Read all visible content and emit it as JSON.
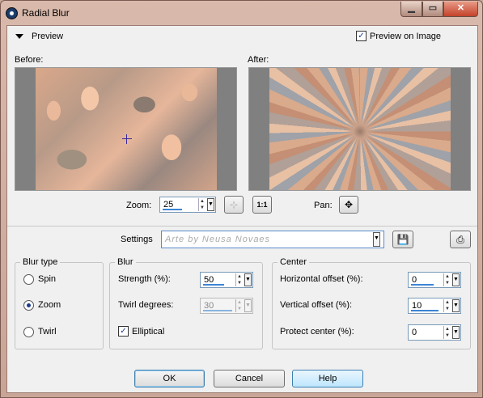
{
  "window": {
    "title": "Radial Blur"
  },
  "preview": {
    "toggle_label": "Preview",
    "preview_on_image_label": "Preview on Image",
    "preview_on_image_checked": true,
    "before_label": "Before:",
    "after_label": "After:",
    "zoom_label": "Zoom:",
    "zoom_value": "25",
    "zoom_fit_icon": "zoom-fit-icon",
    "zoom_actual_label": "1:1",
    "pan_label": "Pan:",
    "pan_icon": "move-icon"
  },
  "settings": {
    "label": "Settings",
    "value": "Arte by Neusa Novaes",
    "save_icon": "save-disk-icon",
    "manage_icon": "manage-presets-icon"
  },
  "blur_type": {
    "title": "Blur type",
    "options": [
      {
        "label": "Spin",
        "selected": false
      },
      {
        "label": "Zoom",
        "selected": true
      },
      {
        "label": "Twirl",
        "selected": false
      }
    ]
  },
  "blur": {
    "title": "Blur",
    "strength_label": "Strength (%):",
    "strength_value": "50",
    "twirl_label": "Twirl degrees:",
    "twirl_value": "30",
    "elliptical_label": "Elliptical",
    "elliptical_checked": true
  },
  "center": {
    "title": "Center",
    "h_offset_label": "Horizontal offset (%):",
    "h_offset_value": "0",
    "v_offset_label": "Vertical offset (%):",
    "v_offset_value": "10",
    "protect_label": "Protect center (%):",
    "protect_value": "0"
  },
  "buttons": {
    "ok": "OK",
    "cancel": "Cancel",
    "help": "Help"
  },
  "colors": {
    "accent": "#3c84d4",
    "title_bar": "#d9b9ab",
    "close": "#c4422a"
  }
}
